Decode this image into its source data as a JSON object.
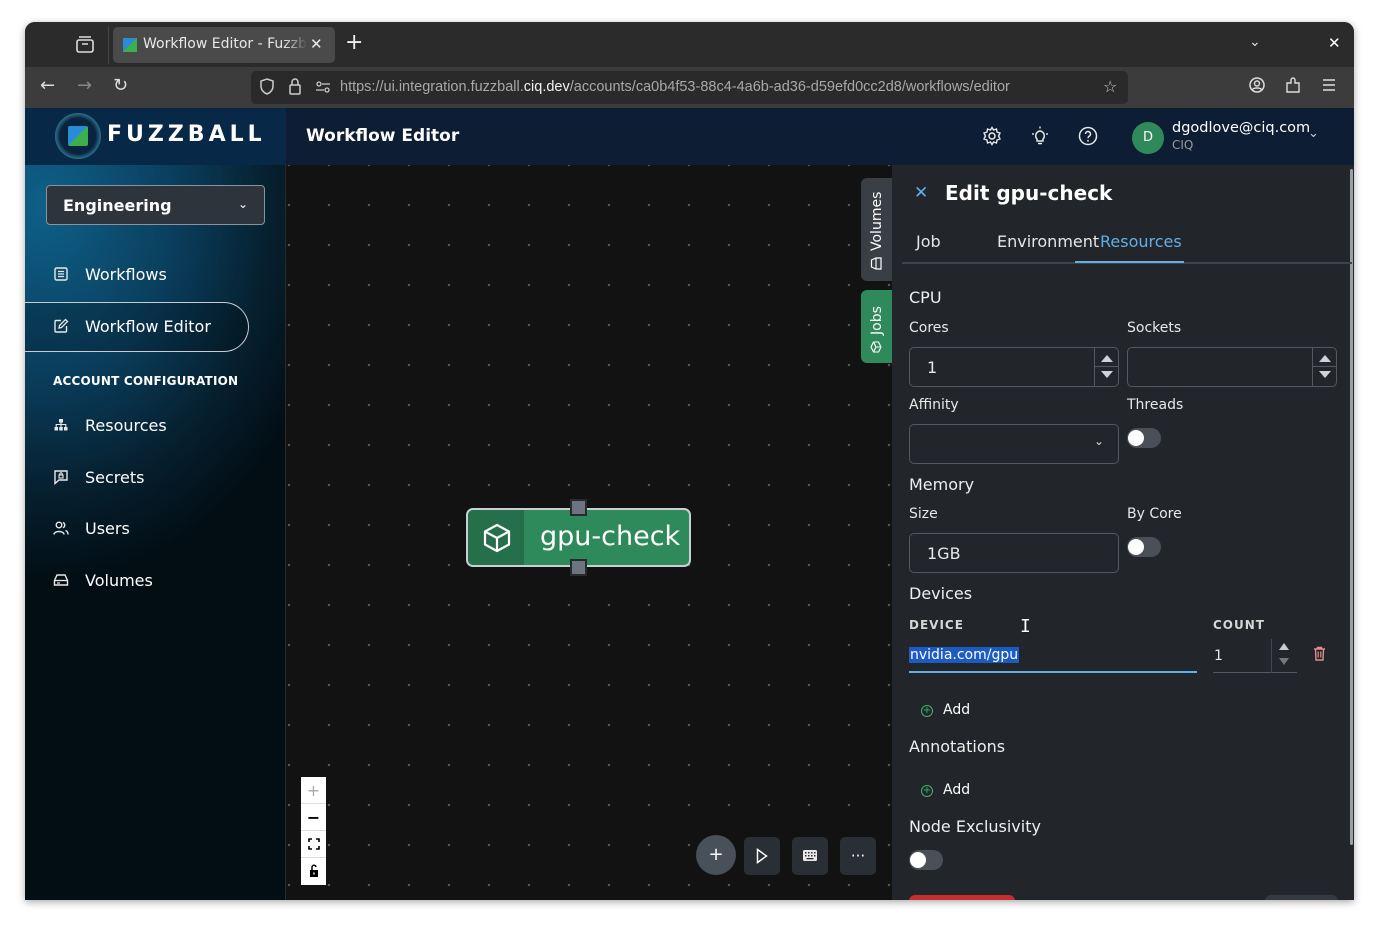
{
  "browser": {
    "tab_title": "Workflow Editor - Fuzzball",
    "url_prefix": "https://ui.integration.fuzzball.",
    "url_domain": "ciq.dev",
    "url_path": "/accounts/ca0b4f53-88c4-4a6b-ad36-d59efd0cc2d8/workflows/editor",
    "icons": {
      "tab_list": "tab-list-icon",
      "new_tab": "+",
      "list_all_tabs": "⌄",
      "close_window": "✕",
      "back": "←",
      "forward": "→",
      "reload": "↻",
      "bookmark": "☆"
    }
  },
  "app": {
    "brand": "FUZZBALL",
    "page_title": "Workflow Editor",
    "user": {
      "initial": "D",
      "email": "dgodlove@ciq.com",
      "org": "CIQ"
    },
    "header_icons": [
      "settings-icon",
      "lightbulb-icon",
      "help-icon"
    ]
  },
  "sidebar": {
    "account": "Engineering",
    "items": [
      {
        "label": "Workflows",
        "icon": "list-icon",
        "active": false
      },
      {
        "label": "Workflow Editor",
        "icon": "edit-icon",
        "active": true
      }
    ],
    "section_label": "ACCOUNT CONFIGURATION",
    "config_items": [
      {
        "label": "Resources",
        "icon": "sitemap-icon"
      },
      {
        "label": "Secrets",
        "icon": "secret-icon"
      },
      {
        "label": "Users",
        "icon": "users-icon"
      },
      {
        "label": "Volumes",
        "icon": "drive-icon"
      }
    ]
  },
  "canvas": {
    "node_label": "gpu-check",
    "side_tabs": {
      "volumes": "Volumes",
      "jobs": "Jobs"
    },
    "zoom_controls": [
      "+",
      "−",
      "⛶",
      "🔓"
    ],
    "fab_buttons": [
      "add",
      "run",
      "keyboard",
      "more"
    ]
  },
  "panel": {
    "title": "Edit gpu-check",
    "tabs": [
      {
        "label": "Job",
        "active": false
      },
      {
        "label": "Environment",
        "active": false
      },
      {
        "label": "Resources",
        "active": true
      }
    ],
    "cpu": {
      "heading": "CPU",
      "cores_label": "Cores",
      "cores_value": "1",
      "sockets_label": "Sockets",
      "sockets_value": "",
      "affinity_label": "Affinity",
      "affinity_value": "",
      "threads_label": "Threads",
      "threads_on": false
    },
    "memory": {
      "heading": "Memory",
      "size_label": "Size",
      "size_value": "1GB",
      "by_core_label": "By Core",
      "by_core_on": false
    },
    "devices": {
      "heading": "Devices",
      "col_device": "DEVICE",
      "col_count": "COUNT",
      "rows": [
        {
          "device": "nvidia.com/gpu",
          "count": "1"
        }
      ],
      "add_label": "Add"
    },
    "annotations": {
      "heading": "Annotations",
      "add_label": "Add"
    },
    "node_exclusivity": {
      "heading": "Node Exclusivity",
      "on": false
    },
    "colors": {
      "accent": "#64aee6",
      "node_green": "#2e8a5a",
      "danger": "#c62e2e"
    }
  }
}
